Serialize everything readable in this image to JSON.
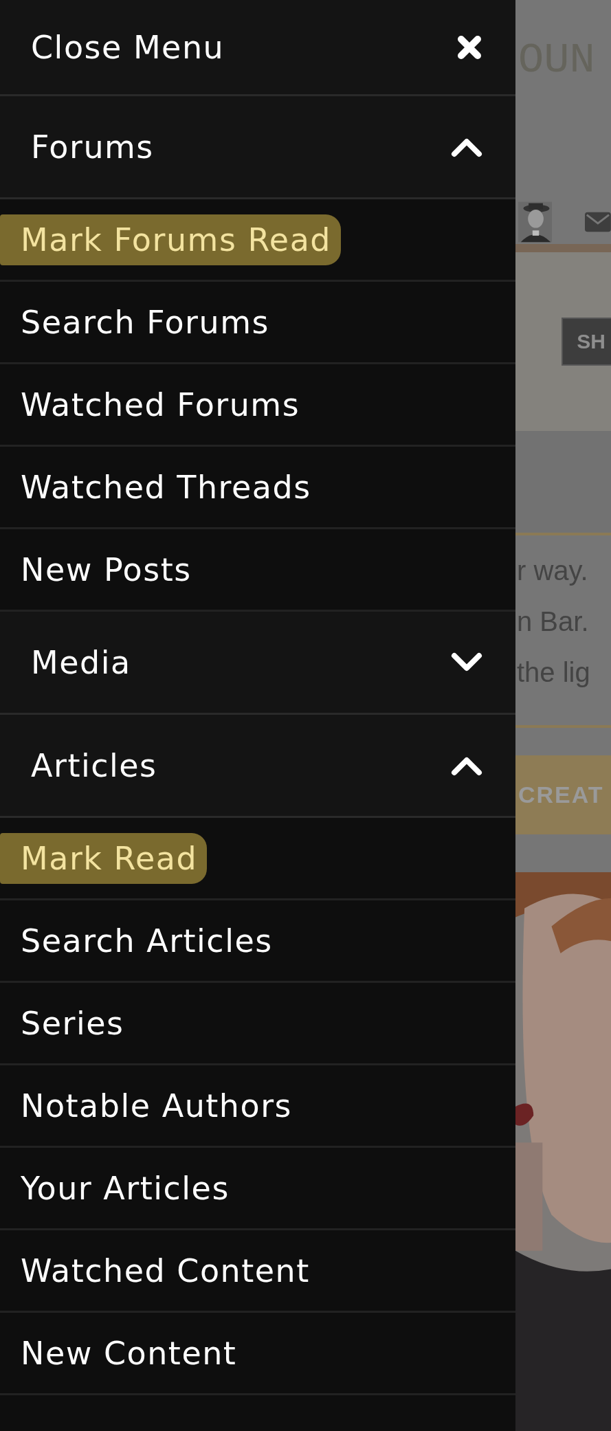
{
  "menu": {
    "close_label": "Close Menu",
    "sections": [
      {
        "label": "Forums",
        "expanded": true,
        "items": [
          {
            "label": "Mark Forums Read",
            "highlighted": true
          },
          {
            "label": "Search Forums",
            "highlighted": false
          },
          {
            "label": "Watched Forums",
            "highlighted": false
          },
          {
            "label": "Watched Threads",
            "highlighted": false
          },
          {
            "label": "New Posts",
            "highlighted": false
          }
        ]
      },
      {
        "label": "Media",
        "expanded": false
      },
      {
        "label": "Articles",
        "expanded": true,
        "items": [
          {
            "label": "Mark Read",
            "highlighted": true
          },
          {
            "label": "Search Articles",
            "highlighted": false
          },
          {
            "label": "Series",
            "highlighted": false
          },
          {
            "label": "Notable Authors",
            "highlighted": false
          },
          {
            "label": "Your Articles",
            "highlighted": false
          },
          {
            "label": "Watched Content",
            "highlighted": false
          },
          {
            "label": "New Content",
            "highlighted": false
          }
        ]
      }
    ]
  },
  "backdrop": {
    "site_title": "OUN",
    "banner_button": "SH",
    "text_lines": [
      "r way.",
      "n Bar.",
      "the lig"
    ],
    "action_button": "CREAT"
  }
}
